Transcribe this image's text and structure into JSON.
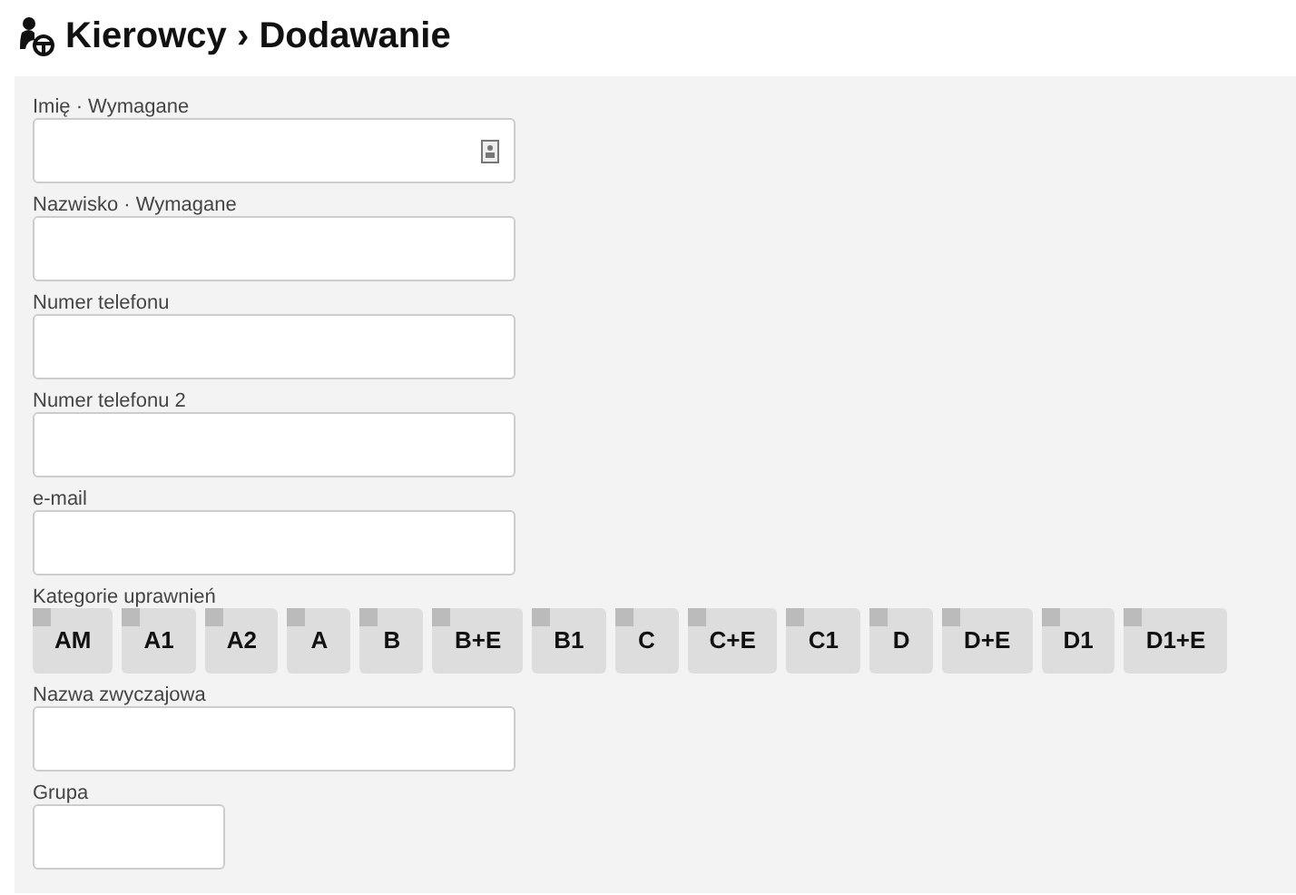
{
  "page": {
    "title": "Kierowcy",
    "separator": "›",
    "subtitle": "Dodawanie"
  },
  "fields": [
    {
      "label": "Imię · Wymagane",
      "kind": "text",
      "has_contact_icon": true
    },
    {
      "label": "Nazwisko · Wymagane",
      "kind": "text",
      "has_contact_icon": false
    },
    {
      "label": "Numer telefonu",
      "kind": "text",
      "has_contact_icon": false
    },
    {
      "label": "Numer telefonu 2",
      "kind": "text",
      "has_contact_icon": false
    },
    {
      "label": "e-mail",
      "kind": "text",
      "has_contact_icon": false
    },
    {
      "label": "Kategorie uprawnień",
      "kind": "categories",
      "options": [
        {
          "label": "AM",
          "checked": false
        },
        {
          "label": "A1",
          "checked": false
        },
        {
          "label": "A2",
          "checked": false
        },
        {
          "label": "A",
          "checked": false
        },
        {
          "label": "B",
          "checked": false
        },
        {
          "label": "B+E",
          "checked": false
        },
        {
          "label": "B1",
          "checked": false
        },
        {
          "label": "C",
          "checked": false
        },
        {
          "label": "C+E",
          "checked": false
        },
        {
          "label": "C1",
          "checked": false
        },
        {
          "label": "D",
          "checked": false
        },
        {
          "label": "D+E",
          "checked": false
        },
        {
          "label": "D1",
          "checked": false
        },
        {
          "label": "D1+E",
          "checked": false
        }
      ]
    },
    {
      "label": "Nazwa zwyczajowa",
      "kind": "text",
      "has_contact_icon": false
    },
    {
      "label": "Grupa",
      "kind": "short",
      "has_contact_icon": false
    }
  ]
}
